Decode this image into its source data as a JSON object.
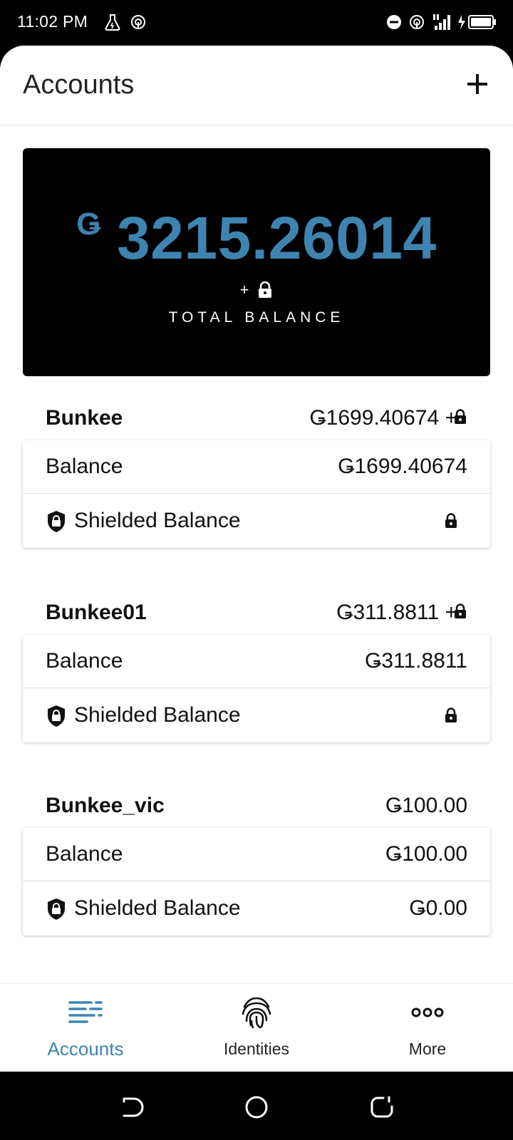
{
  "status_bar": {
    "time": "11:02 PM"
  },
  "header": {
    "title": "Accounts",
    "add_icon": "plus-icon"
  },
  "total": {
    "currency": "Ǥ",
    "amount": "3215.26014",
    "plus": "+",
    "label": "TOTAL BALANCE"
  },
  "accounts": [
    {
      "name": "Bunkee",
      "head_amount": "Ǥ1699.40674 +",
      "balance_label": "Balance",
      "balance_value": "Ǥ1699.40674",
      "shielded_label": "Shielded Balance",
      "shielded_value": ""
    },
    {
      "name": "Bunkee01",
      "head_amount": "Ǥ311.8811 +",
      "balance_label": "Balance",
      "balance_value": "Ǥ311.8811",
      "shielded_label": "Shielded Balance",
      "shielded_value": ""
    },
    {
      "name": "Bunkee_vic",
      "head_amount": "Ǥ100.00",
      "balance_label": "Balance",
      "balance_value": "Ǥ100.00",
      "shielded_label": "Shielded Balance",
      "shielded_value": "Ǥ0.00"
    }
  ],
  "bottom_nav": {
    "items": [
      {
        "label": "Accounts",
        "icon": "accounts-list-icon",
        "active": true
      },
      {
        "label": "Identities",
        "icon": "fingerprint-icon",
        "active": false
      },
      {
        "label": "More",
        "icon": "more-dots-icon",
        "active": false
      }
    ]
  },
  "colors": {
    "accent": "#3e84b0",
    "card_dark": "#000000"
  }
}
